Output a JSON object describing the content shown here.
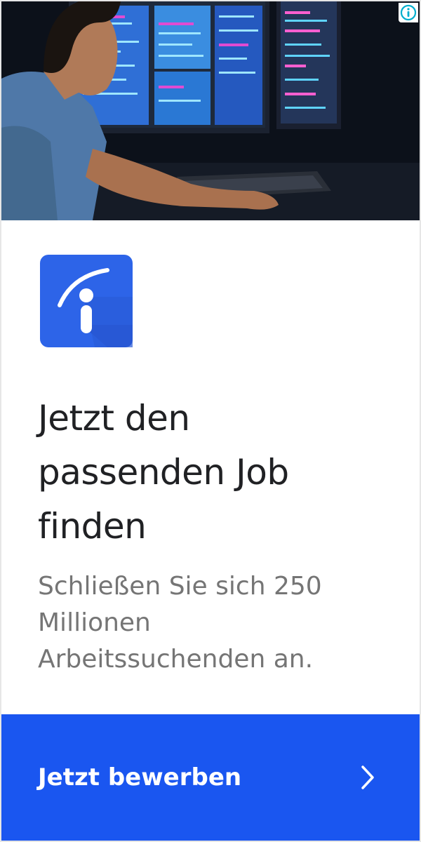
{
  "ad": {
    "hero_image": "developer-at-computer-photo",
    "info_icon": "info-icon",
    "logo_icon": "indeed-logo-icon",
    "headline_lines": [
      "Jetzt den",
      "passenden Job",
      "finden"
    ],
    "subtext_lines": [
      "Schließen Sie sich 250",
      "Millionen",
      "Arbeitssuchenden an."
    ],
    "cta_label": "Jetzt bewerben",
    "cta_icon": "chevron-right-icon"
  },
  "colors": {
    "brand_blue": "#1a56f0",
    "logo_blue": "#2d64e8",
    "headline": "#202124",
    "subtext": "#757575",
    "info_icon": "#00aecd"
  }
}
